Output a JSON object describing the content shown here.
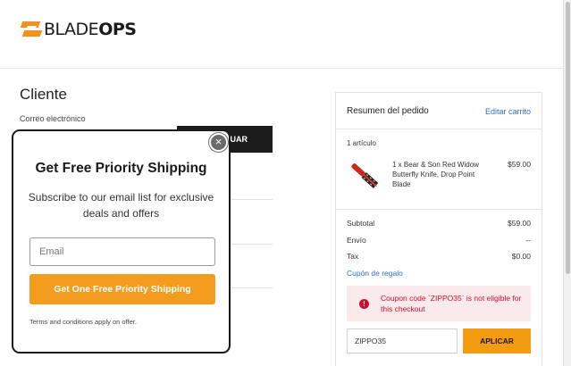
{
  "header": {
    "logo_light": "BLADE",
    "logo_bold": "OPS"
  },
  "checkout": {
    "section_title": "Cliente",
    "email_label": "Correo electrónico",
    "continue_label": "UAR"
  },
  "summary": {
    "title": "Resumen del pedido",
    "edit_link": "Editar carrito",
    "item_count": "1 artículo",
    "item": {
      "description": "1 x Bear & Son Red Widow Butterfly Knife, Drop Point Blade",
      "price": "$59.00",
      "image_icon": "knife-icon"
    },
    "rows": [
      {
        "label": "Subtotal",
        "value": "$59.00"
      },
      {
        "label": "Envío",
        "value": "--"
      },
      {
        "label": "Tax",
        "value": "$0.00"
      }
    ],
    "coupon_link": "Cupón de regalo",
    "alert": {
      "icon": "!",
      "message": "Coupon code `ZIPPO35` is not eligible for this checkout"
    },
    "coupon_value": "ZIPPO35",
    "apply_label": "APLICAR"
  },
  "modal": {
    "close_icon": "×",
    "title": "Get Free Priority Shipping",
    "subtitle": "Subscribe to our email list for exclusive deals and offers",
    "email_placeholder": "Email",
    "cta_label": "Get One Free Priority Shipping",
    "terms": "Terms and conditions apply on offer."
  },
  "colors": {
    "accent": "#f39c12",
    "link": "#2d6fc4",
    "error": "#c8102e",
    "error_bg": "#fbeaec"
  }
}
